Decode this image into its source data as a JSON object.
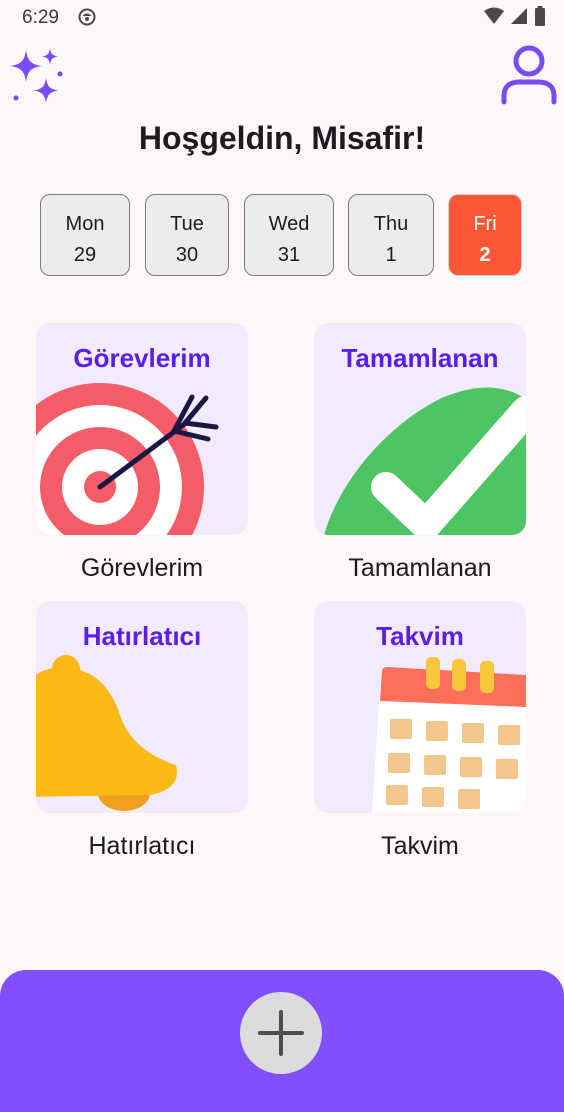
{
  "status_bar": {
    "time": "6:29",
    "icons": [
      "app-notification-icon",
      "wifi-icon",
      "signal-icon",
      "battery-icon"
    ]
  },
  "header": {
    "left_icon": "sparkles-icon",
    "right_icon": "profile-icon",
    "title": "Hoşgeldin, Misafir!"
  },
  "days": [
    {
      "name": "Mon",
      "num": "29",
      "selected": false
    },
    {
      "name": "Tue",
      "num": "30",
      "selected": false
    },
    {
      "name": "Wed",
      "num": "31",
      "selected": false
    },
    {
      "name": "Thu",
      "num": "1",
      "selected": false
    },
    {
      "name": "Fri",
      "num": "2",
      "selected": true
    }
  ],
  "cards": [
    {
      "title": "Görevlerim",
      "caption": "Görevlerim",
      "icon": "target-arrow-icon"
    },
    {
      "title": "Tamamlanan",
      "caption": "Tamamlanan",
      "icon": "checkmark-icon"
    },
    {
      "title": "Hatırlatıcı",
      "caption": "Hatırlatıcı",
      "icon": "bell-icon"
    },
    {
      "title": "Takvim",
      "caption": "Takvim",
      "icon": "calendar-icon"
    }
  ],
  "bottom_bar": {
    "fab_icon": "plus-icon"
  },
  "colors": {
    "accent": "#8150fc",
    "card_title": "#5b1ee6",
    "card_bg": "#f1ebfd",
    "selected_day": "#fd5637",
    "background": "#fdf7f8"
  }
}
